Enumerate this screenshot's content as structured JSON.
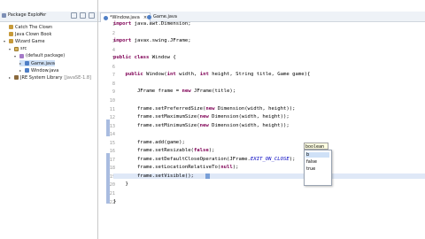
{
  "package_explorer": {
    "tab_label": "Package Explorer",
    "close_glyph": "×",
    "items": [
      {
        "label": "Catch The Clown",
        "icon": "project-icon",
        "indent": 0,
        "twisty": ""
      },
      {
        "label": "Java Clown Book",
        "icon": "project-icon",
        "indent": 0,
        "twisty": ""
      },
      {
        "label": "Wizard Game",
        "icon": "project-icon",
        "indent": 0,
        "twisty": "▾"
      },
      {
        "label": "src",
        "icon": "source-folder-icon",
        "indent": 1,
        "twisty": "▾"
      },
      {
        "label": "(default package)",
        "icon": "package-icon",
        "indent": 2,
        "twisty": "▾"
      },
      {
        "label": "Game.java",
        "icon": "java-file-icon",
        "indent": 3,
        "twisty": "▸"
      },
      {
        "label": "Window.java",
        "icon": "java-file-icon",
        "indent": 3,
        "twisty": "▸"
      },
      {
        "label": "JRE System Library",
        "suffix": "[JavaSE-1.8]",
        "icon": "library-icon",
        "indent": 1,
        "twisty": "▸"
      }
    ]
  },
  "editor": {
    "tabs": [
      {
        "label": "*Window.java",
        "close": "×",
        "active": true
      },
      {
        "label": "Game.java",
        "close": "",
        "active": false
      }
    ],
    "line_numbers": [
      "1",
      "2",
      "3",
      "4",
      "5",
      "6",
      "7",
      "8",
      "9",
      "10",
      "11",
      "12",
      "13",
      "14",
      "15",
      "16",
      "17",
      "18",
      "19",
      "20",
      "21",
      "22"
    ],
    "lines": [
      [
        {
          "t": "import",
          "c": "kw"
        },
        {
          "t": " java.awt.Dimension;"
        }
      ],
      [],
      [
        {
          "t": "import",
          "c": "kw"
        },
        {
          "t": " javax.swing.JFrame;"
        }
      ],
      [],
      [
        {
          "t": "public class",
          "c": "kw"
        },
        {
          "t": " Window {"
        }
      ],
      [],
      [
        {
          "t": "    "
        },
        {
          "t": "public",
          "c": "kw"
        },
        {
          "t": " Window("
        },
        {
          "t": "int",
          "c": "kw"
        },
        {
          "t": " width, "
        },
        {
          "t": "int",
          "c": "kw"
        },
        {
          "t": " height, String title, Game game){"
        }
      ],
      [],
      [
        {
          "t": "        JFrame frame = "
        },
        {
          "t": "new",
          "c": "kw"
        },
        {
          "t": " JFrame(title);"
        }
      ],
      [],
      [
        {
          "t": "        frame.setPreferredSize("
        },
        {
          "t": "new",
          "c": "kw"
        },
        {
          "t": " Dimension(width, height));"
        }
      ],
      [
        {
          "t": "        frame.setMaximumSize("
        },
        {
          "t": "new",
          "c": "kw"
        },
        {
          "t": " Dimension(width, height));"
        }
      ],
      [
        {
          "t": "        frame.setMinimumSize("
        },
        {
          "t": "new",
          "c": "kw"
        },
        {
          "t": " Dimension(width, height));"
        }
      ],
      [],
      [
        {
          "t": "        frame.add(game);"
        }
      ],
      [
        {
          "t": "        frame.setResizable("
        },
        {
          "t": "false",
          "c": "kw"
        },
        {
          "t": ");"
        }
      ],
      [
        {
          "t": "        frame.setDefaultCloseOperation(JFrame."
        },
        {
          "t": "EXIT_ON_CLOSE",
          "c": "it"
        },
        {
          "t": ");"
        }
      ],
      [
        {
          "t": "        frame.setLocationRelativeTo("
        },
        {
          "t": "null",
          "c": "kw"
        },
        {
          "t": ");"
        }
      ],
      [
        {
          "t": "        frame.setVisible();"
        }
      ],
      [
        {
          "t": "    }"
        }
      ],
      [],
      [
        {
          "t": "}"
        }
      ]
    ],
    "param_hint": "boolean b",
    "autocomplete": [
      "b",
      "false",
      "true"
    ]
  },
  "colors": {
    "keyword": "#7f0055",
    "constant": "#0000c0",
    "selection": "#cfe1f7",
    "change_marker": "#a9bce0"
  }
}
